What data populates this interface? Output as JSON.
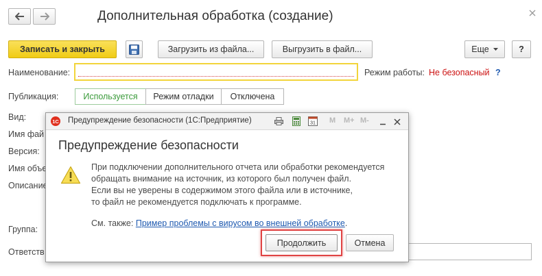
{
  "window": {
    "title": "Дополнительная обработка (создание)",
    "back_icon": "arrow-left-icon",
    "forward_icon": "arrow-right-icon",
    "close_icon": "close-icon"
  },
  "toolbar": {
    "save_close": "Записать и закрыть",
    "load_file": "Загрузить из файла...",
    "unload_file": "Выгрузить в файл...",
    "more": "Еще",
    "help": "?"
  },
  "form": {
    "name_label": "Наименование:",
    "name_value": "",
    "mode_label": "Режим работы:",
    "mode_value": "Не безопасный",
    "mode_help": "?",
    "publication_label": "Публикация:",
    "publication_options": [
      "Используется",
      "Режим отладки",
      "Отключена"
    ],
    "publication_selected": "Используется",
    "kind_label": "Вид:",
    "file_label": "Имя фай",
    "version_label": "Версия:",
    "object_label": "Имя объе",
    "description_label": "Описание",
    "group_label": "Группа:",
    "responsible_label": "Ответств"
  },
  "dialog": {
    "title": "Предупреждение безопасности (1С:Предприятие)",
    "heading": "Предупреждение безопасности",
    "message_lines": [
      "При подключении дополнительного отчета или обработки рекомендуется",
      "обращать внимание на источник, из которого был получен файл.",
      "Если вы не уверены в содержимом этого файла или в источнике,",
      "то файл не рекомендуется подключать к программе."
    ],
    "see_also": "См. также:",
    "link": "Пример проблемы с вирусом во внешней обработке",
    "link_end": ".",
    "continue": "Продолжить",
    "cancel": "Отмена",
    "tool_m": "M",
    "tool_mplus": "M+",
    "tool_mminus": "M-"
  },
  "colors": {
    "primary_button": "#f5d524",
    "highlight": "#e04444",
    "link": "#1f5ab0",
    "mode_value": "#cc1111",
    "selected_segment": "#3a9a3a"
  }
}
